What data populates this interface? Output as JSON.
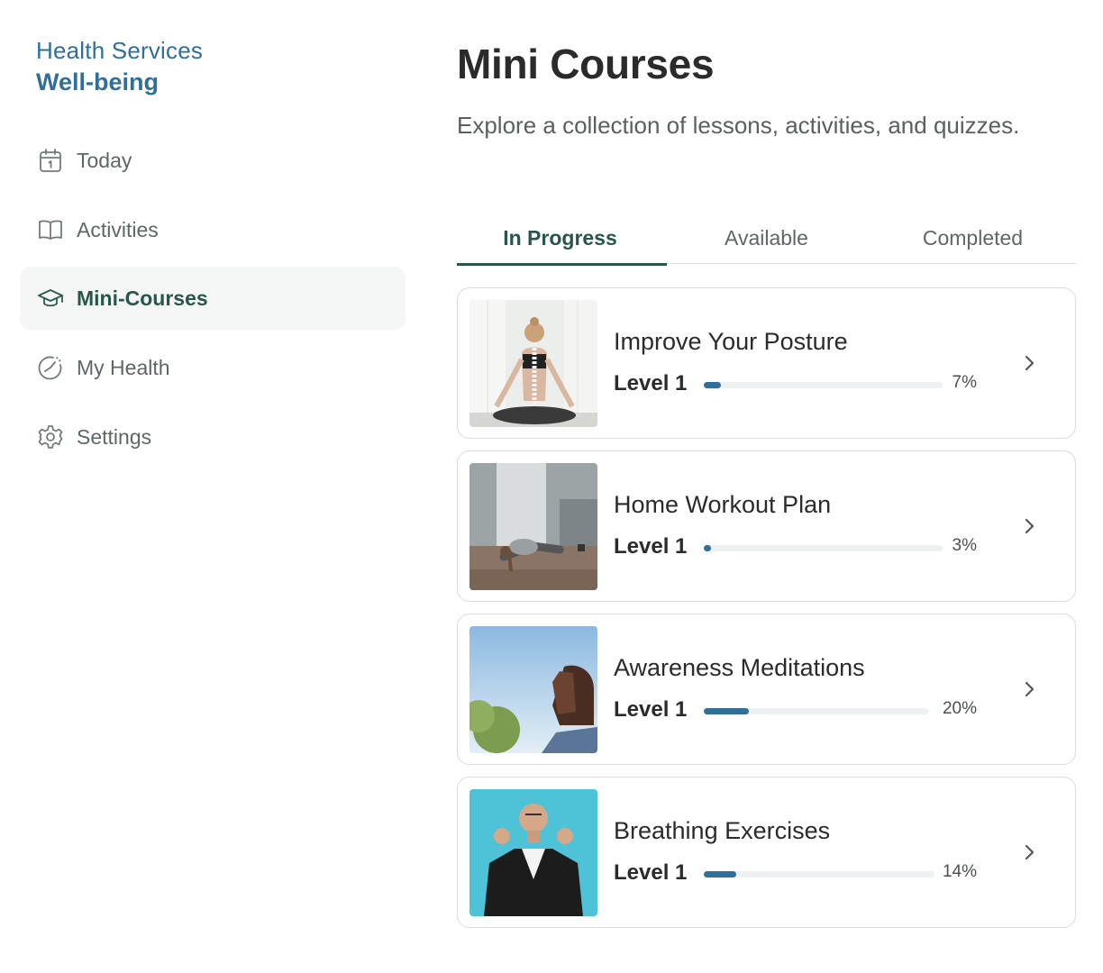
{
  "brand": {
    "line1": "Health Services",
    "line2": "Well-being",
    "color": "#2f6f99"
  },
  "sidebar": {
    "items": [
      {
        "label": "Today",
        "icon": "calendar-icon",
        "active": false
      },
      {
        "label": "Activities",
        "icon": "book-icon",
        "active": false
      },
      {
        "label": "Mini-Courses",
        "icon": "graduation-cap-icon",
        "active": true
      },
      {
        "label": "My Health",
        "icon": "gauge-icon",
        "active": false
      },
      {
        "label": "Settings",
        "icon": "gear-icon",
        "active": false
      }
    ],
    "active_color": "#28564b"
  },
  "main": {
    "title": "Mini Courses",
    "subtitle": "Explore a collection of lessons, activities, and quizzes.",
    "tabs": [
      {
        "label": "In Progress",
        "active": true
      },
      {
        "label": "Available",
        "active": false
      },
      {
        "label": "Completed",
        "active": false
      }
    ],
    "courses": [
      {
        "title": "Improve Your Posture",
        "level": "Level 1",
        "percent_label": "7%",
        "progress": 0.07,
        "image": "posture-photo"
      },
      {
        "title": "Home Workout Plan",
        "level": "Level 1",
        "percent_label": "3%",
        "progress": 0.03,
        "image": "workout-photo"
      },
      {
        "title": "Awareness Meditations",
        "level": "Level 1",
        "percent_label": "20%",
        "progress": 0.2,
        "image": "meditation-photo"
      },
      {
        "title": "Breathing Exercises",
        "level": "Level 1",
        "percent_label": "14%",
        "progress": 0.14,
        "image": "breathing-photo"
      }
    ],
    "progress_color": "#2f6f99"
  }
}
